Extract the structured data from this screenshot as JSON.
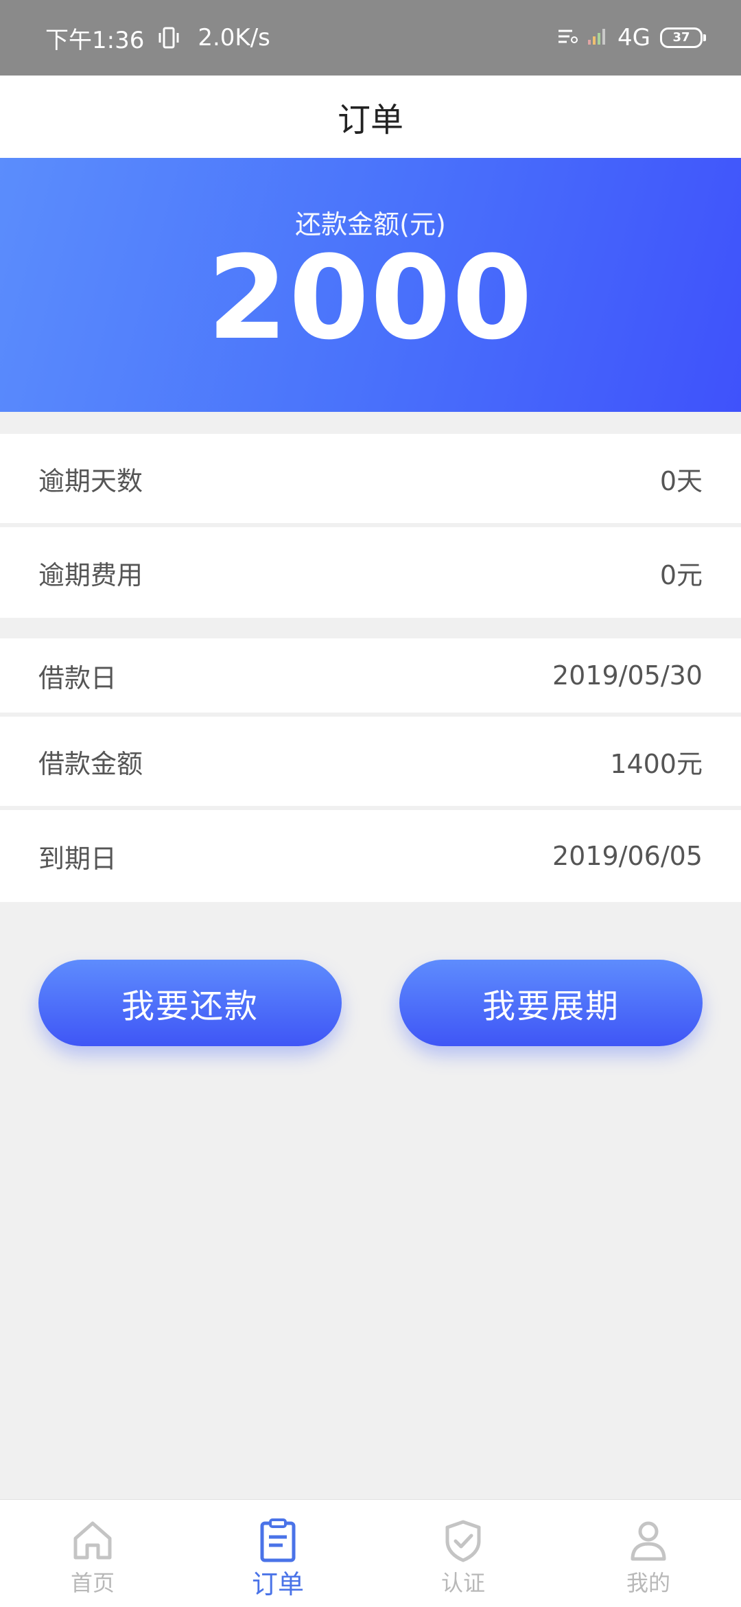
{
  "status_bar": {
    "time": "下午1:36",
    "speed": "2.0K/s",
    "network": "4G",
    "battery": "37"
  },
  "header": {
    "title": "订单"
  },
  "summary": {
    "label": "还款金额(元)",
    "amount": "2000"
  },
  "details": [
    {
      "label": "逾期天数",
      "value": "0天"
    },
    {
      "label": "逾期费用",
      "value": "0元"
    },
    {
      "label": "借款日",
      "value": "2019/05/30"
    },
    {
      "label": "借款金额",
      "value": "1400元"
    },
    {
      "label": "到期日",
      "value": "2019/06/05"
    }
  ],
  "actions": {
    "repay_label": "我要还款",
    "extend_label": "我要展期"
  },
  "tabs": [
    {
      "label": "首页",
      "icon": "home-icon"
    },
    {
      "label": "订单",
      "icon": "order-icon",
      "active": true
    },
    {
      "label": "认证",
      "icon": "shield-check-icon"
    },
    {
      "label": "我的",
      "icon": "user-icon"
    }
  ],
  "colors": {
    "accent": "#4a73e8",
    "hero_start": "#5b8dfc",
    "hero_end": "#3f52fb",
    "inactive_tab": "#b8b8b8"
  }
}
